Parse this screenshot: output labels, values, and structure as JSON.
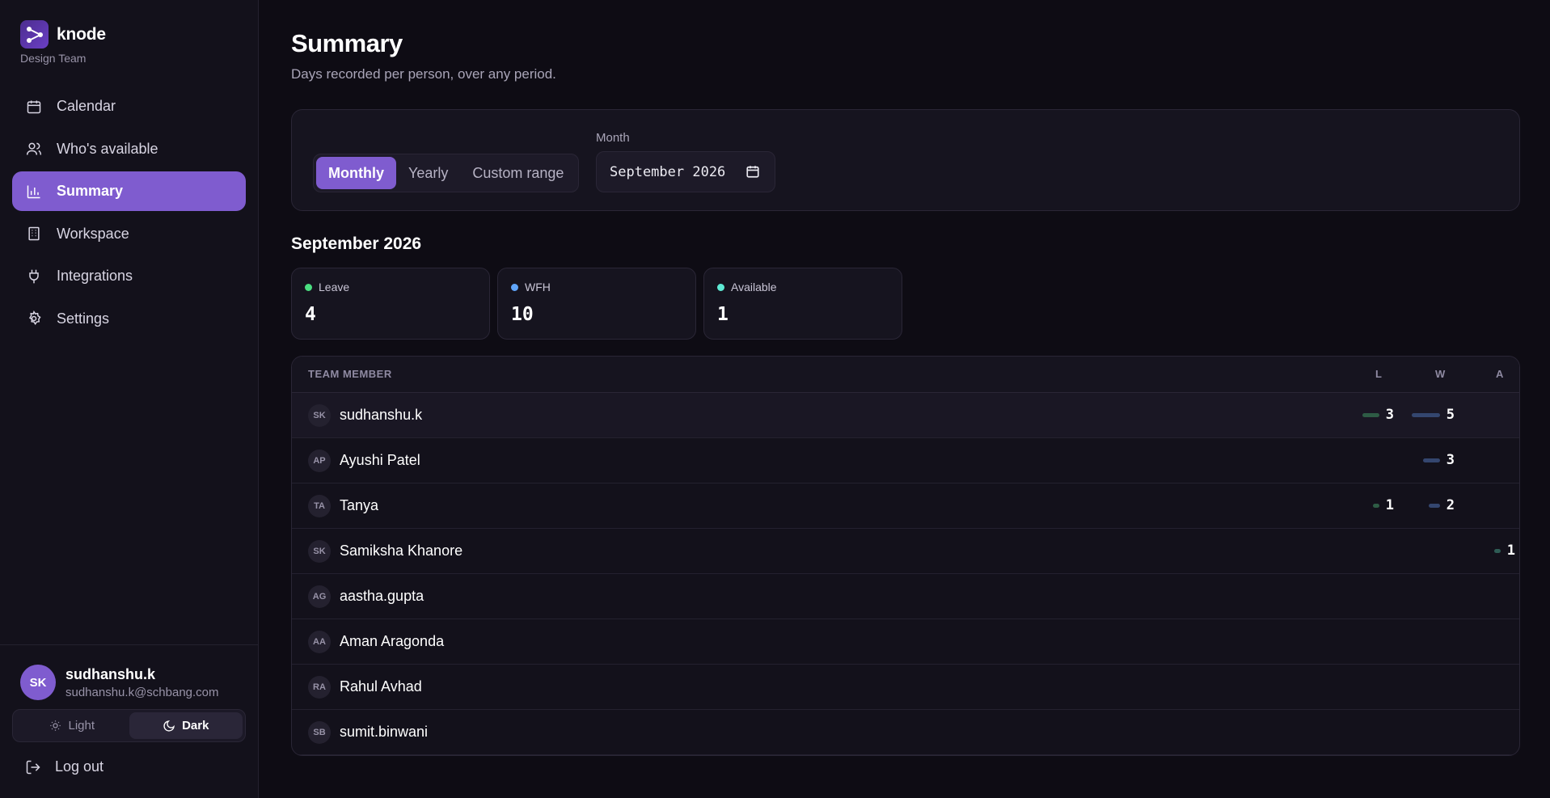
{
  "sidebar": {
    "brand_name": "knode",
    "team": "Design Team",
    "nav": [
      {
        "label": "Calendar",
        "icon": "calendar-icon"
      },
      {
        "label": "Who's available",
        "icon": "users-icon"
      },
      {
        "label": "Summary",
        "icon": "bar-chart-icon",
        "active": true
      },
      {
        "label": "Workspace",
        "icon": "building-icon"
      },
      {
        "label": "Integrations",
        "icon": "plug-icon"
      },
      {
        "label": "Settings",
        "icon": "gear-icon"
      }
    ],
    "user": {
      "initials": "SK",
      "name": "sudhanshu.k",
      "email": "sudhanshu.k@schbang.com"
    },
    "theme": {
      "light_label": "Light",
      "dark_label": "Dark",
      "selected": "Dark"
    },
    "logout_label": "Log out"
  },
  "main": {
    "title": "Summary",
    "subtitle": "Days recorded per person, over any period.",
    "period_tabs": [
      {
        "label": "Monthly",
        "active": true
      },
      {
        "label": "Yearly"
      },
      {
        "label": "Custom range"
      }
    ],
    "month_label": "Month",
    "month_value": "September 2026",
    "period_title": "September 2026",
    "stats": [
      {
        "label": "Leave",
        "value": "4",
        "color": "#4ade80"
      },
      {
        "label": "WFH",
        "value": "10",
        "color": "#60a5fa"
      },
      {
        "label": "Available",
        "value": "1",
        "color": "#5eead4"
      }
    ],
    "table": {
      "headers": {
        "member": "TEAM MEMBER",
        "l": "L",
        "w": "W",
        "a": "A"
      },
      "rows": [
        {
          "initials": "SK",
          "name": "sudhanshu.k",
          "l": "3",
          "w": "5",
          "a": ""
        },
        {
          "initials": "AP",
          "name": "Ayushi Patel",
          "l": "",
          "w": "3",
          "a": ""
        },
        {
          "initials": "TA",
          "name": "Tanya",
          "l": "1",
          "w": "2",
          "a": ""
        },
        {
          "initials": "SK",
          "name": "Samiksha Khanore",
          "l": "",
          "w": "",
          "a": "1"
        },
        {
          "initials": "AG",
          "name": "aastha.gupta",
          "l": "",
          "w": "",
          "a": ""
        },
        {
          "initials": "AA",
          "name": "Aman Aragonda",
          "l": "",
          "w": "",
          "a": ""
        },
        {
          "initials": "RA",
          "name": "Rahul Avhad",
          "l": "",
          "w": "",
          "a": ""
        },
        {
          "initials": "SB",
          "name": "sumit.binwani",
          "l": "",
          "w": "",
          "a": ""
        }
      ]
    },
    "colors": {
      "accent": "#7f5ccf",
      "leave_bar": "#2e5c45",
      "wfh_bar": "#34466f",
      "available_bar": "#2e5c55"
    }
  }
}
